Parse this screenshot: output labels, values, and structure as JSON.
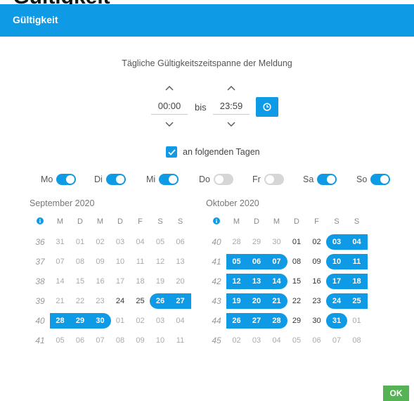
{
  "clipped_top_text": "-  Gültigkeit",
  "dialog": {
    "title": "Gültigkeit"
  },
  "headline": "Tägliche Gültigkeitszeitspanne der Meldung",
  "time": {
    "from": "00:00",
    "separator": "bis",
    "to": "23:59"
  },
  "daily_checkbox": {
    "label": "an folgenden Tagen",
    "checked": true
  },
  "weekdays": [
    {
      "label": "Mo",
      "on": true
    },
    {
      "label": "Di",
      "on": true
    },
    {
      "label": "Mi",
      "on": true
    },
    {
      "label": "Do",
      "on": false
    },
    {
      "label": "Fr",
      "on": false
    },
    {
      "label": "Sa",
      "on": true
    },
    {
      "label": "So",
      "on": true
    }
  ],
  "day_headers": [
    "M",
    "D",
    "M",
    "D",
    "F",
    "S",
    "S"
  ],
  "calendars": [
    {
      "title": "September 2020",
      "weeks": [
        {
          "wk": "36",
          "days": [
            [
              "31",
              0,
              0
            ],
            [
              "01",
              0,
              0
            ],
            [
              "02",
              0,
              0
            ],
            [
              "03",
              0,
              0
            ],
            [
              "04",
              0,
              0
            ],
            [
              "05",
              0,
              0
            ],
            [
              "06",
              0,
              0
            ]
          ]
        },
        {
          "wk": "37",
          "days": [
            [
              "07",
              0,
              0
            ],
            [
              "08",
              0,
              0
            ],
            [
              "09",
              0,
              0
            ],
            [
              "10",
              0,
              0
            ],
            [
              "11",
              0,
              0
            ],
            [
              "12",
              0,
              0
            ],
            [
              "13",
              0,
              0
            ]
          ]
        },
        {
          "wk": "38",
          "days": [
            [
              "14",
              0,
              0
            ],
            [
              "15",
              0,
              0
            ],
            [
              "16",
              0,
              0
            ],
            [
              "17",
              0,
              0
            ],
            [
              "18",
              0,
              0
            ],
            [
              "19",
              0,
              0
            ],
            [
              "20",
              0,
              0
            ]
          ]
        },
        {
          "wk": "39",
          "days": [
            [
              "21",
              0,
              0
            ],
            [
              "22",
              0,
              0
            ],
            [
              "23",
              0,
              0
            ],
            [
              "24",
              1,
              0
            ],
            [
              "25",
              1,
              0
            ],
            [
              "26",
              1,
              1
            ],
            [
              "27",
              1,
              1
            ]
          ]
        },
        {
          "wk": "40",
          "days": [
            [
              "28",
              1,
              1
            ],
            [
              "29",
              1,
              1
            ],
            [
              "30",
              1,
              1
            ],
            [
              "01",
              0,
              0
            ],
            [
              "02",
              0,
              0
            ],
            [
              "03",
              0,
              0
            ],
            [
              "04",
              0,
              0
            ]
          ]
        },
        {
          "wk": "41",
          "days": [
            [
              "05",
              0,
              0
            ],
            [
              "06",
              0,
              0
            ],
            [
              "07",
              0,
              0
            ],
            [
              "08",
              0,
              0
            ],
            [
              "09",
              0,
              0
            ],
            [
              "10",
              0,
              0
            ],
            [
              "11",
              0,
              0
            ]
          ]
        }
      ]
    },
    {
      "title": "Oktober 2020",
      "weeks": [
        {
          "wk": "40",
          "days": [
            [
              "28",
              0,
              0
            ],
            [
              "29",
              0,
              0
            ],
            [
              "30",
              0,
              0
            ],
            [
              "01",
              1,
              0
            ],
            [
              "02",
              1,
              0
            ],
            [
              "03",
              1,
              1
            ],
            [
              "04",
              1,
              1
            ]
          ]
        },
        {
          "wk": "41",
          "days": [
            [
              "05",
              1,
              1
            ],
            [
              "06",
              1,
              1
            ],
            [
              "07",
              1,
              1
            ],
            [
              "08",
              1,
              0
            ],
            [
              "09",
              1,
              0
            ],
            [
              "10",
              1,
              1
            ],
            [
              "11",
              1,
              1
            ]
          ]
        },
        {
          "wk": "42",
          "days": [
            [
              "12",
              1,
              1
            ],
            [
              "13",
              1,
              1
            ],
            [
              "14",
              1,
              1
            ],
            [
              "15",
              1,
              0
            ],
            [
              "16",
              1,
              0
            ],
            [
              "17",
              1,
              1
            ],
            [
              "18",
              1,
              1
            ]
          ]
        },
        {
          "wk": "43",
          "days": [
            [
              "19",
              1,
              1
            ],
            [
              "20",
              1,
              1
            ],
            [
              "21",
              1,
              1
            ],
            [
              "22",
              1,
              0
            ],
            [
              "23",
              1,
              0
            ],
            [
              "24",
              1,
              1
            ],
            [
              "25",
              1,
              1
            ]
          ]
        },
        {
          "wk": "44",
          "days": [
            [
              "26",
              1,
              1
            ],
            [
              "27",
              1,
              1
            ],
            [
              "28",
              1,
              1
            ],
            [
              "29",
              1,
              0
            ],
            [
              "30",
              1,
              0
            ],
            [
              "31",
              1,
              1
            ],
            [
              "01",
              0,
              0
            ]
          ]
        },
        {
          "wk": "45",
          "days": [
            [
              "02",
              0,
              0
            ],
            [
              "03",
              0,
              0
            ],
            [
              "04",
              0,
              0
            ],
            [
              "05",
              0,
              0
            ],
            [
              "06",
              0,
              0
            ],
            [
              "07",
              0,
              0
            ],
            [
              "08",
              0,
              0
            ]
          ]
        }
      ]
    }
  ],
  "ok_button": {
    "label": "OK"
  },
  "colors": {
    "accent": "#0f9ae6",
    "ok": "#55b356",
    "toggle_off": "#d6d6d6"
  }
}
